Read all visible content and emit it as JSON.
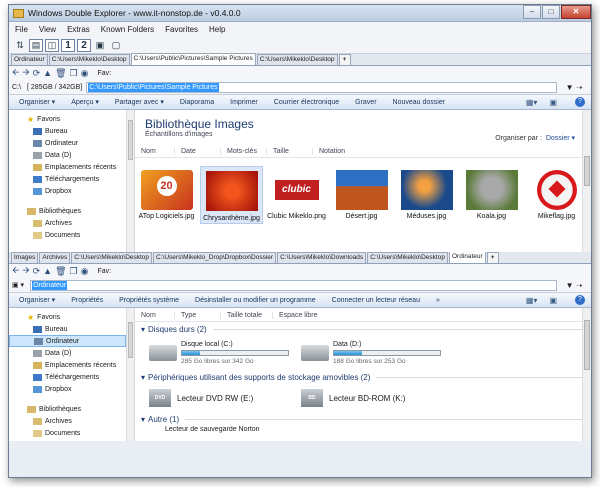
{
  "window": {
    "title": "Windows Double Explorer - www.it-nonstop.de - v0.4.0.0",
    "buttons": [
      "–",
      "□",
      "✕"
    ]
  },
  "menu": [
    "File",
    "View",
    "Extras",
    "Known Folders",
    "Favorites",
    "Help"
  ],
  "toolbar": {
    "num1": "1",
    "num2": "2"
  },
  "top": {
    "tabs": [
      "Ordinateur",
      "C:\\Users\\Mikeklo\\Desktop",
      "C:\\Users\\Public\\Pictures\\Sample Pictures",
      "C:\\Users\\Mikeklo\\Desktop"
    ],
    "active_tab": 2,
    "fav_label": "Fav:",
    "drive": "C:\\",
    "space": "[ 285GB / 342GB]",
    "path": "C:\\Users\\Public\\Pictures\\Sample Pictures",
    "commands": [
      "Organiser ▾",
      "Aperçu ▾",
      "Partager avec ▾",
      "Diaporama",
      "Imprimer",
      "Courrier électronique",
      "Graver",
      "Nouveau dossier"
    ],
    "nav": [
      "Favoris",
      "Bureau",
      "Ordinateur",
      "Data (D)",
      "Emplacements récents",
      "Téléchargements",
      "Dropbox",
      "Bibliothèques",
      "Archives",
      "Documents"
    ],
    "lib_title": "Bibliothèque Images",
    "lib_sub": "Échantillons d'images",
    "organize_label": "Organiser par :",
    "organize_value": "Dossier ▾",
    "columns": [
      "Nom",
      "Date",
      "Mots-clés",
      "Taille",
      "Notation"
    ],
    "files": [
      {
        "name": "ATop Logiciels.jpg",
        "colors": [
          "#f0a020",
          "#c8321e"
        ]
      },
      {
        "name": "Chrysanthème.jpg",
        "colors": [
          "#f3551d",
          "#a4150a"
        ]
      },
      {
        "name": "Clubic Mikeklo.png",
        "colors": [
          "#ffffff",
          "#c02020"
        ]
      },
      {
        "name": "Désert.jpg",
        "colors": [
          "#2d6fc2",
          "#c0561f"
        ]
      },
      {
        "name": "Méduses.jpg",
        "colors": [
          "#1a4a8c",
          "#f2a040"
        ]
      },
      {
        "name": "Koala.jpg",
        "colors": [
          "#5a7a3a",
          "#a9a9a9"
        ]
      },
      {
        "name": "Mikeflag.jpg",
        "colors": [
          "#f4f4f4",
          "#d8191c"
        ]
      }
    ],
    "badge_20": "20",
    "clubic_text": "clubic"
  },
  "bottom": {
    "tabs": [
      "Images",
      "Archives",
      "C:\\Users\\Mikeklo\\Desktop",
      "C:\\Users\\Mikeklo_Drop\\Dropbox\\Dossier",
      "C:\\Users\\Mikeklo\\Downloads",
      "C:\\Users\\Mikeklo\\Desktop",
      "Ordinateur"
    ],
    "active_tab": 6,
    "fav_label": "Fav:",
    "path": "Ordinateur",
    "commands": [
      "Organiser ▾",
      "Propriétés",
      "Propriétés système",
      "Désinstaller ou modifier un programme",
      "Connecter un lecteur réseau",
      "»"
    ],
    "nav": [
      "Favoris",
      "Bureau",
      "Ordinateur",
      "Data (D)",
      "Emplacements récents",
      "Téléchargements",
      "Dropbox",
      "Bibliothèques",
      "Archives",
      "Documents"
    ],
    "columns": [
      "Nom",
      "Type",
      "Taille totale",
      "Espace libre"
    ],
    "groups": [
      "Disques durs (2)",
      "Périphériques utilisant des supports de stockage amovibles (2)",
      "Autre (1)"
    ],
    "disks": [
      {
        "name": "Disque local (C:)",
        "free": "285 Go libres sur 342 Go",
        "used": 0.17
      },
      {
        "name": "Data (D:)",
        "free": "188 Go libres sur 253 Go",
        "used": 0.26
      }
    ],
    "removable": [
      {
        "name": "Lecteur DVD RW (E:)",
        "label": "DVD"
      },
      {
        "name": "Lecteur BD-ROM (K:)",
        "label": "BD"
      }
    ],
    "other": "Lecteur de sauvegarde Norton"
  }
}
